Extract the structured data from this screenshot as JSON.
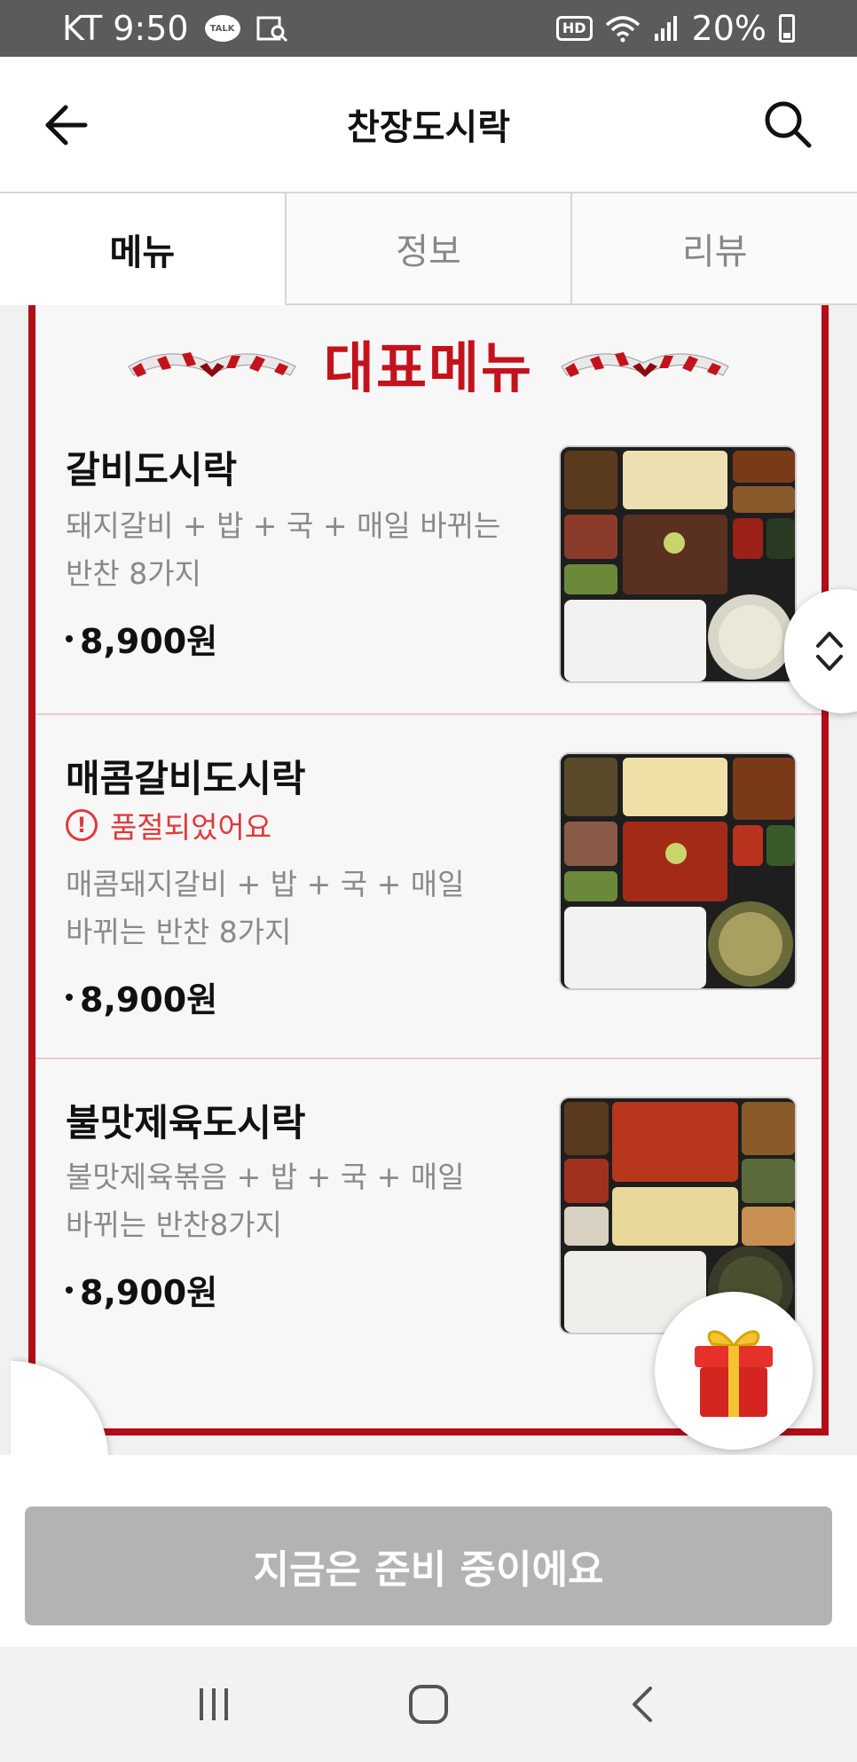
{
  "status_bar": {
    "carrier_time": "KT 9:50",
    "talk_badge": "TALK",
    "hd": "HD",
    "battery": "20%"
  },
  "header": {
    "title": "찬장도시락",
    "back_icon": "arrow-left-icon",
    "search_icon": "search-icon"
  },
  "tabs": [
    {
      "label": "메뉴",
      "active": true
    },
    {
      "label": "정보",
      "active": false
    },
    {
      "label": "리뷰",
      "active": false
    }
  ],
  "section": {
    "title": "대표메뉴"
  },
  "menu_items": [
    {
      "name": "갈비도시락",
      "desc_line1": "돼지갈비 + 밥 + 국 + 매일 바뀌는",
      "desc_line2": "반찬 8가지",
      "price": "8,900원"
    },
    {
      "name": "매콤갈비도시락",
      "soldout": "품절되었어요",
      "desc_line1": "매콤돼지갈비 + 밥 + 국 + 매일",
      "desc_line2": "바뀌는 반찬 8가지",
      "price": "8,900원"
    },
    {
      "name": "불맛제육도시락",
      "desc_line1": "불맛제육볶음 + 밥 + 국 + 매일",
      "desc_line2": "바뀌는 반찬8가지",
      "price": "8,900원"
    }
  ],
  "bottom_button": {
    "label": "지금은 준비 중이에요"
  },
  "colors": {
    "accent_red": "#b10e18",
    "soldout_red": "#e0393b",
    "disabled_gray": "#b3b3b3"
  }
}
